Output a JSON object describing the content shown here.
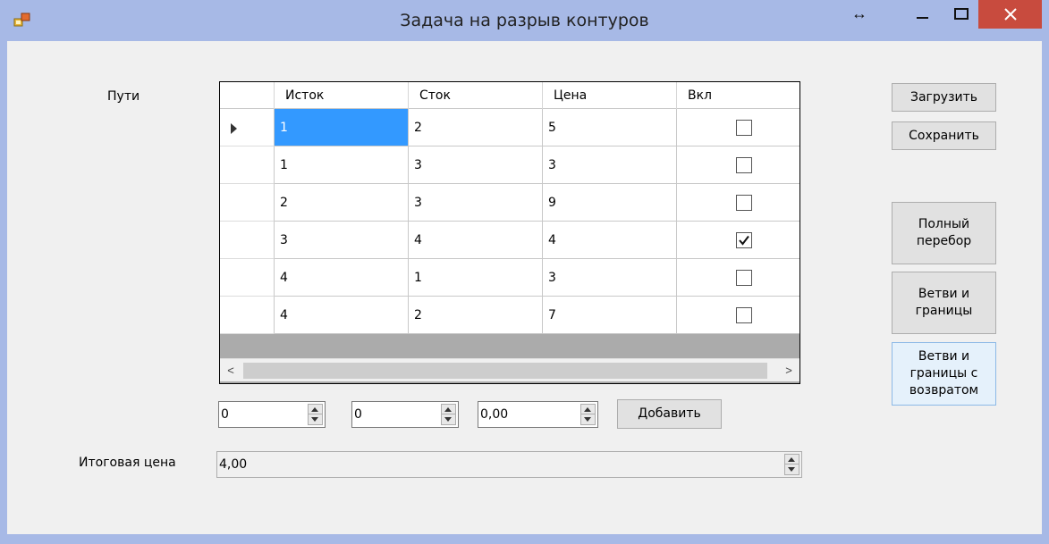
{
  "window": {
    "title": "Задача на разрыв контуров"
  },
  "labels": {
    "paths": "Пути",
    "total_price": "Итоговая цена"
  },
  "grid": {
    "columns": [
      "Исток",
      "Сток",
      "Цена",
      "Вкл"
    ],
    "rows": [
      {
        "source": "1",
        "sink": "2",
        "price": "5",
        "enabled": false
      },
      {
        "source": "1",
        "sink": "3",
        "price": "3",
        "enabled": false
      },
      {
        "source": "2",
        "sink": "3",
        "price": "9",
        "enabled": false
      },
      {
        "source": "3",
        "sink": "4",
        "price": "4",
        "enabled": true
      },
      {
        "source": "4",
        "sink": "1",
        "price": "3",
        "enabled": false
      },
      {
        "source": "4",
        "sink": "2",
        "price": "7",
        "enabled": false
      }
    ]
  },
  "inputs": {
    "source_value": "0",
    "sink_value": "0",
    "price_value": "0,00",
    "total_price_value": "4,00"
  },
  "buttons": {
    "load": "Загрузить",
    "save": "Сохранить",
    "full_search": "Полный\nперебор",
    "branch_bound": "Ветви и\nграницы",
    "branch_bound_backtrack": "Ветви и\nграницы с\nвозвратом",
    "add": "Добавить"
  },
  "colors": {
    "selection": "#3399ff",
    "close_button": "#c84b3e",
    "titlebar": "#a7b9e6"
  }
}
